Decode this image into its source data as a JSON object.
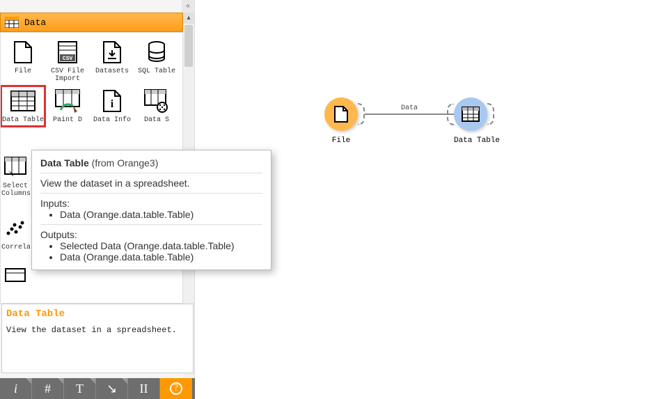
{
  "sidebar": {
    "category_label": "Data",
    "widgets_row1": [
      {
        "label": "File"
      },
      {
        "label": "CSV File Import"
      },
      {
        "label": "Datasets"
      },
      {
        "label": "SQL Table"
      }
    ],
    "widgets_row2": [
      {
        "label": "Data Table"
      },
      {
        "label": "Paint D"
      },
      {
        "label": "Data Info"
      },
      {
        "label": "Data S"
      }
    ],
    "widgets_cut": [
      {
        "label": "Select Columns"
      },
      {
        "label": "Correla"
      }
    ]
  },
  "tooltip": {
    "title": "Data Table",
    "source": " (from Orange3)",
    "summary": "View the dataset in a spreadsheet.",
    "inputs_label": "Inputs:",
    "inputs": [
      "Data (Orange.data.table.Table)"
    ],
    "outputs_label": "Outputs:",
    "outputs": [
      "Selected Data (Orange.data.table.Table)",
      "Data (Orange.data.table.Table)"
    ]
  },
  "info_panel": {
    "title": "Data Table",
    "desc": "View the dataset in a spreadsheet."
  },
  "bottom_tools": {
    "info": "i",
    "grid": "#",
    "text": "T",
    "arrow": "↘",
    "pause": "II",
    "help": "?"
  },
  "canvas": {
    "node1_label": "File",
    "node2_label": "Data Table",
    "link_label": "Data"
  }
}
